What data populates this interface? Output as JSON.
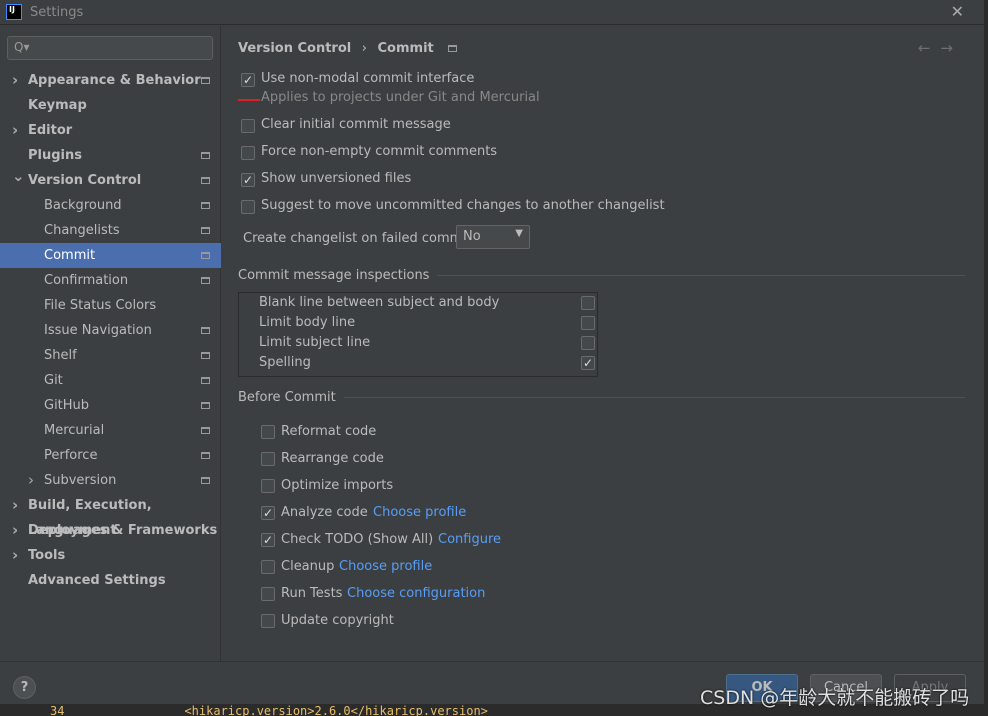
{
  "window": {
    "title": "Settings",
    "close": "✕"
  },
  "search": {
    "placeholder": "Q▾"
  },
  "sidebar": {
    "items": [
      {
        "label": "Appearance & Behavior"
      },
      {
        "label": "Keymap"
      },
      {
        "label": "Editor"
      },
      {
        "label": "Plugins"
      },
      {
        "label": "Version Control"
      },
      {
        "label": "Background"
      },
      {
        "label": "Changelists"
      },
      {
        "label": "Commit"
      },
      {
        "label": "Confirmation"
      },
      {
        "label": "File Status Colors"
      },
      {
        "label": "Issue Navigation"
      },
      {
        "label": "Shelf"
      },
      {
        "label": "Git"
      },
      {
        "label": "GitHub"
      },
      {
        "label": "Mercurial"
      },
      {
        "label": "Perforce"
      },
      {
        "label": "Subversion"
      },
      {
        "label": "Build, Execution, Deployment"
      },
      {
        "label": "Languages & Frameworks"
      },
      {
        "label": "Tools"
      },
      {
        "label": "Advanced Settings"
      }
    ],
    "selected": "Commit"
  },
  "breadcrumb": {
    "parent": "Version Control",
    "sep": "›",
    "current": "Commit",
    "back": "←",
    "forward": "→"
  },
  "options": [
    {
      "label": "Use non-modal commit interface",
      "checked": true,
      "hint": "Applies to projects under Git and Mercurial"
    },
    {
      "label": "Clear initial commit message",
      "checked": false
    },
    {
      "label": "Force non-empty commit comments",
      "checked": false
    },
    {
      "label": "Show unversioned files",
      "checked": true
    },
    {
      "label": "Suggest to move uncommitted changes to another changelist",
      "checked": false
    }
  ],
  "changelist": {
    "label": "Create changelist on failed commit:",
    "value": "No"
  },
  "inspections": {
    "title": "Commit message inspections",
    "rows": [
      {
        "label": "Blank line between subject and body",
        "checked": false
      },
      {
        "label": "Limit body line",
        "checked": false
      },
      {
        "label": "Limit subject line",
        "checked": false
      },
      {
        "label": "Spelling",
        "checked": true
      }
    ]
  },
  "before_commit": {
    "title": "Before Commit",
    "items": [
      {
        "label": "Reformat code",
        "checked": false,
        "link": ""
      },
      {
        "label": "Rearrange code",
        "checked": false,
        "link": ""
      },
      {
        "label": "Optimize imports",
        "checked": false,
        "link": ""
      },
      {
        "label": "Analyze code",
        "checked": true,
        "link": "Choose profile"
      },
      {
        "label": "Check TODO (Show All)",
        "checked": true,
        "link": "Configure"
      },
      {
        "label": "Cleanup",
        "checked": false,
        "link": "Choose profile"
      },
      {
        "label": "Run Tests",
        "checked": false,
        "link": "Choose configuration"
      },
      {
        "label": "Update copyright",
        "checked": false,
        "link": ""
      }
    ]
  },
  "footer": {
    "help": "?",
    "ok": "OK",
    "cancel": "Cancel",
    "apply": "Apply"
  },
  "background_editor": {
    "line": "34",
    "code": "<hikaricp.version>2.6.0</hikaricp.version>"
  },
  "watermark": "CSDN @年龄大就不能搬砖了吗",
  "colors": {
    "selection": "#4b6eaf",
    "link": "#589df6",
    "ok_button": "#365880"
  }
}
